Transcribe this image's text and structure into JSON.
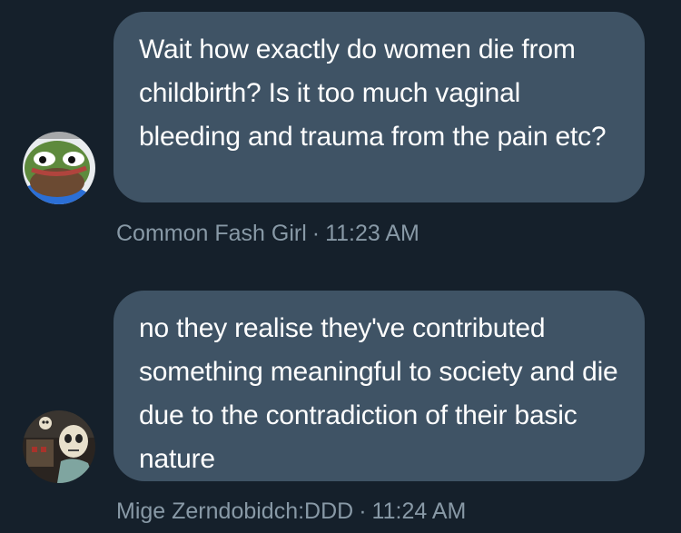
{
  "messages": [
    {
      "avatar": "pepe-frog-avatar",
      "text": "Wait how exactly do women die from childbirth?  Is it too much vaginal bleeding and trauma from the pain etc?",
      "sender": "Common Fash Girl",
      "separator": "·",
      "time": "11:23 AM"
    },
    {
      "avatar": "skull-figure-avatar",
      "text": "no they realise they've contributed something meaningful to society and die due to the contradiction of their basic nature",
      "sender": "Mige Zerndobidch:DDD",
      "separator": "·",
      "time": "11:24 AM"
    }
  ],
  "colors": {
    "background": "#15202b",
    "bubble": "#3f5365",
    "text": "#ffffff",
    "meta": "#8899a6"
  }
}
